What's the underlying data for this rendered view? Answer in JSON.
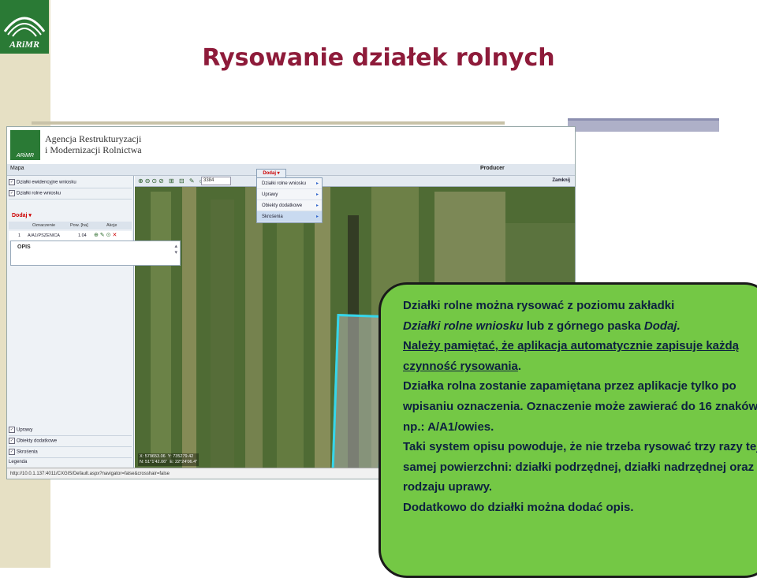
{
  "slide": {
    "logo_text": "ARiMR",
    "title": "Rysowanie działek rolnych"
  },
  "app": {
    "agency_line1": "Agencja Restrukturyzacji",
    "agency_line2": "i Modernizacji Rolnictwa",
    "tab_map": "Mapa",
    "producer_label": "Producer",
    "close_label": "Zamknij",
    "url": "http://10.0.1.137:4011/CXGIS/Default.aspx?navigator=false&crosshair=false"
  },
  "left_panel": {
    "layers_top": [
      "Działki ewidencyjne wniosku",
      "Działki rolne wniosku"
    ],
    "dodaj_label": "Dodaj",
    "columns": [
      "Oznaczenie",
      "Pow. [ha]",
      "Akcje"
    ],
    "row": {
      "index": "1",
      "oznaczenie": "A/A1/PSZENICA",
      "pow": "1.04"
    },
    "opis_label": "OPIS",
    "layers_bottom": [
      "Uprawy",
      "Obiekty dodatkowe",
      "Skrośenia"
    ],
    "legend_label": "Legenda"
  },
  "toolbar": {
    "scale_value": "3384",
    "dodaj_button": "Dodaj"
  },
  "dodaj_menu": {
    "items": [
      "Działki rolne wniosku",
      "Uprawy",
      "Obiekty dodatkowe",
      "Skrośenia"
    ],
    "selected_index": 3
  },
  "map": {
    "coord_x": "X: 579653.06",
    "coord_y": "Y: 735279.42",
    "coord_n": "N: 51°1'42.06\"",
    "coord_e": "E: 22°24'06.4\"",
    "plot_color": "#35d6ea"
  },
  "callout": {
    "p1a": "Działki rolne można rysować z poziomu zakładki",
    "p1b_italic": "Działki rolne wniosku",
    "p1c": " lub z górnego paska ",
    "p1d_italic": "Dodaj.",
    "p2": "Należy pamiętać, że aplikacja automatycznie zapisuje każdą czynność rysowania",
    "p2_end": ".",
    "p3": "Działka rolna zostanie zapamiętana przez aplikacje tylko po wpisaniu oznaczenia. Oznaczenie może zawierać do 16 znaków np.: A/A1/owies.",
    "p4": "Taki system opisu powoduje, że nie trzeba rysować trzy razy tej samej powierzchni: działki podrzędnej, działki nadrzędnej oraz rodzaju uprawy.",
    "p5": "Dodatkowo do działki można dodać opis.",
    "bg_color": "#74c845",
    "text_color": "#0d2140"
  }
}
